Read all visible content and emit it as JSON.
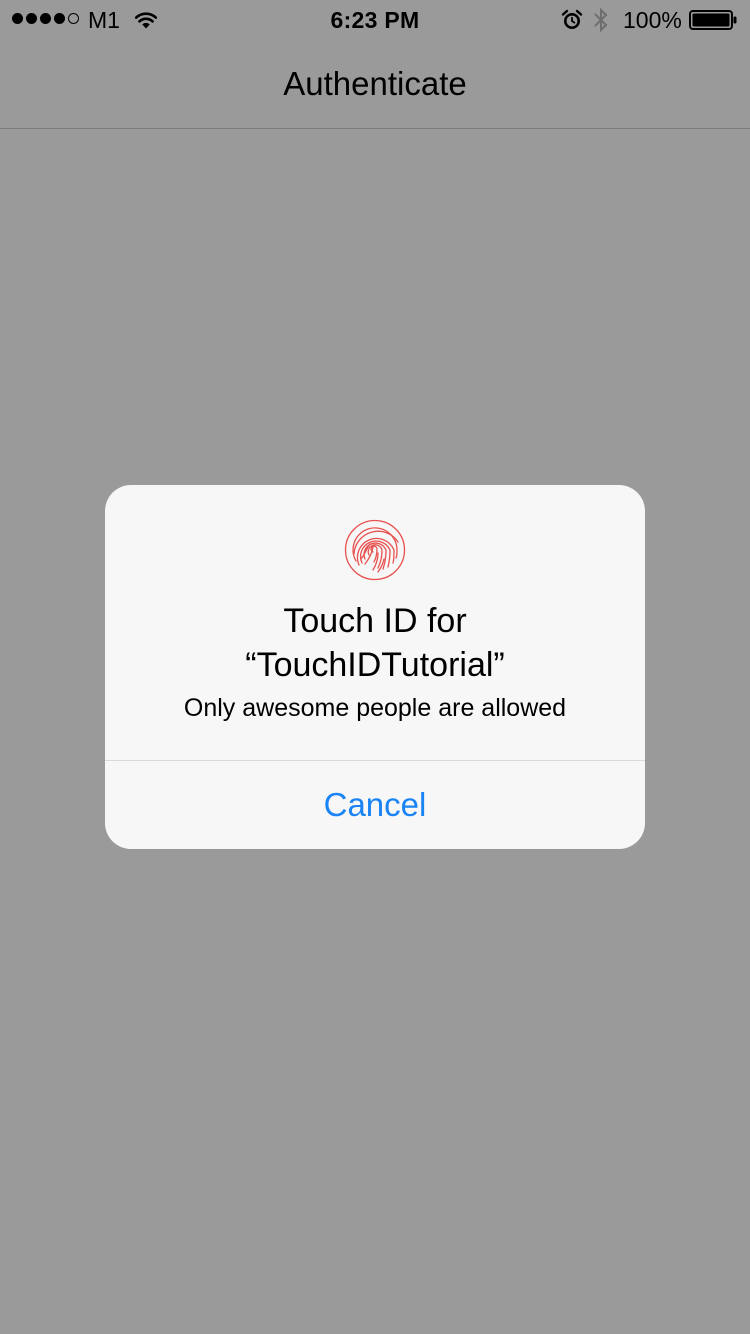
{
  "status_bar": {
    "carrier": "M1",
    "signal_dots": [
      true,
      true,
      true,
      true,
      false
    ],
    "time": "6:23 PM",
    "battery_percent": "100%",
    "icons": [
      "wifi-icon",
      "alarm-icon",
      "bluetooth-icon",
      "battery-icon"
    ],
    "battery_level": 1.0
  },
  "nav": {
    "title": "Authenticate"
  },
  "alert": {
    "icon": "fingerprint-icon",
    "title_line1": "Touch ID for",
    "title_line2": "“TouchIDTutorial”",
    "message": "Only awesome people are allowed",
    "cancel_label": "Cancel"
  },
  "colors": {
    "background_dim": "#9a9a9a",
    "alert_background": "#f7f7f7",
    "accent": "#1a84f4",
    "fingerprint": "#e8514f"
  }
}
